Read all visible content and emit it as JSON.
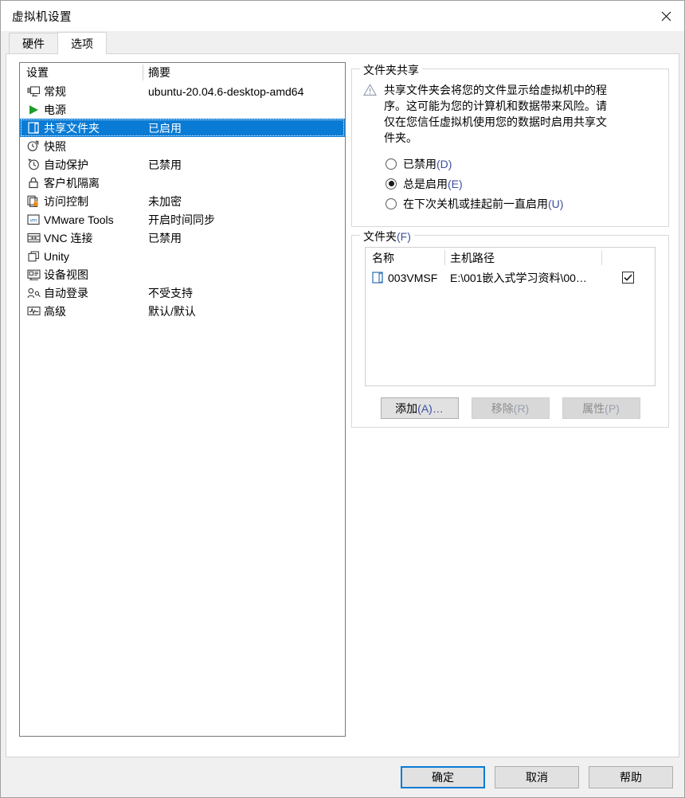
{
  "window": {
    "title": "虚拟机设置",
    "close_icon": "close-icon"
  },
  "tabs": [
    {
      "label": "硬件",
      "active": false
    },
    {
      "label": "选项",
      "active": true
    }
  ],
  "settings_list": {
    "headers": {
      "name": "设置",
      "summary": "摘要"
    },
    "rows": [
      {
        "icon": "monitor-icon",
        "label": "常规",
        "summary": "ubuntu-20.04.6-desktop-amd64",
        "selected": false
      },
      {
        "icon": "power-play-icon",
        "label": "电源",
        "summary": "",
        "selected": false
      },
      {
        "icon": "shared-folder-icon",
        "label": "共享文件夹",
        "summary": "已启用",
        "selected": true
      },
      {
        "icon": "snapshot-icon",
        "label": "快照",
        "summary": "",
        "selected": false
      },
      {
        "icon": "autoprotect-icon",
        "label": "自动保护",
        "summary": "已禁用",
        "selected": false
      },
      {
        "icon": "lock-icon",
        "label": "客户机隔离",
        "summary": "",
        "selected": false
      },
      {
        "icon": "access-control-icon",
        "label": "访问控制",
        "summary": "未加密",
        "selected": false
      },
      {
        "icon": "vmware-tools-icon",
        "label": "VMware Tools",
        "summary": "开启时间同步",
        "selected": false
      },
      {
        "icon": "vnc-icon",
        "label": "VNC 连接",
        "summary": "已禁用",
        "selected": false
      },
      {
        "icon": "unity-icon",
        "label": "Unity",
        "summary": "",
        "selected": false
      },
      {
        "icon": "device-view-icon",
        "label": "设备视图",
        "summary": "",
        "selected": false
      },
      {
        "icon": "auto-login-icon",
        "label": "自动登录",
        "summary": "不受支持",
        "selected": false
      },
      {
        "icon": "advanced-icon",
        "label": "高级",
        "summary": "默认/默认",
        "selected": false
      }
    ]
  },
  "folder_sharing": {
    "group_title": "文件夹共享",
    "warning_icon": "warning-triangle-icon",
    "warning_text": "共享文件夹会将您的文件显示给虚拟机中的程序。这可能为您的计算机和数据带来风险。请仅在您信任虚拟机使用您的数据时启用共享文件夹。",
    "options": [
      {
        "label": "已禁用",
        "accel": "(D)",
        "selected": false
      },
      {
        "label": "总是启用",
        "accel": "(E)",
        "selected": true
      },
      {
        "label": "在下次关机或挂起前一直启用",
        "accel": "(U)",
        "selected": false
      }
    ]
  },
  "folders": {
    "group_title": "文件夹",
    "group_accel": "(F)",
    "headers": {
      "name": "名称",
      "host_path": "主机路径"
    },
    "rows": [
      {
        "icon": "shared-folder-icon",
        "name": "003VMSF",
        "host_path": "E:\\001嵌入式学习资料\\00…",
        "enabled": true
      }
    ],
    "buttons": [
      {
        "label": "添加",
        "accel": "(A)…",
        "disabled": false,
        "name": "add-folder-button"
      },
      {
        "label": "移除",
        "accel": "(R)",
        "disabled": true,
        "name": "remove-folder-button"
      },
      {
        "label": "属性",
        "accel": "(P)",
        "disabled": true,
        "name": "folder-properties-button"
      }
    ]
  },
  "footer": {
    "ok": "确定",
    "cancel": "取消",
    "help": "帮助"
  },
  "colors": {
    "selection": "#0a7bd4",
    "accent_text": "#3b4fa0",
    "folder_icon": "#2a6fb5",
    "power_green": "#1f9d2a",
    "lock_orange": "#e88a1a"
  }
}
